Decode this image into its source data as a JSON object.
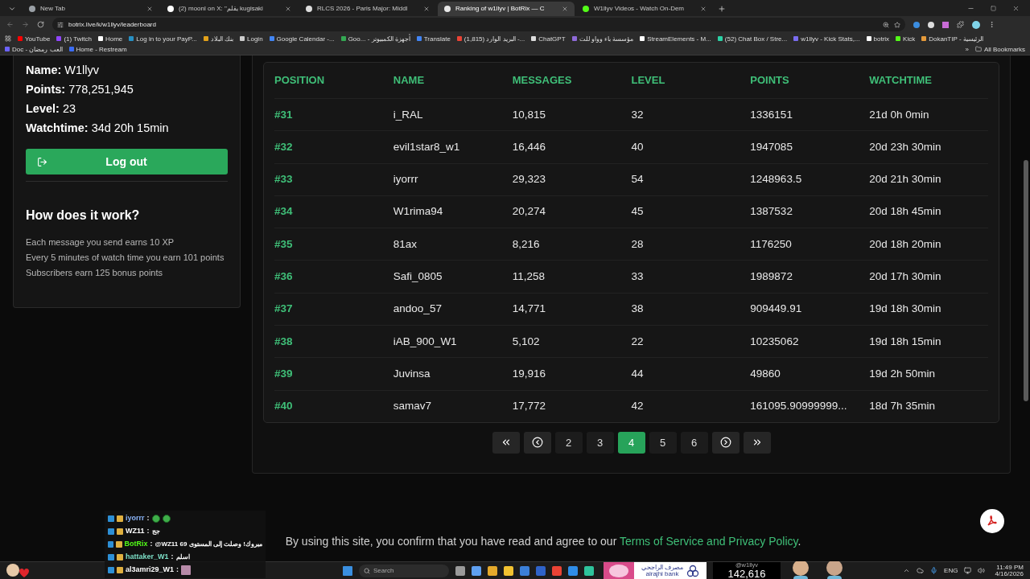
{
  "browser": {
    "tabs": [
      {
        "title": "New Tab",
        "selected": false,
        "color": "#9aa0a6"
      },
      {
        "title": "(2) moonl on X: \"يقلم kugisaki",
        "selected": false,
        "color": "#ffffff"
      },
      {
        "title": "RLCS 2026 - Paris Major: Middl",
        "selected": false,
        "color": "#dddddd"
      },
      {
        "title": "Ranking of w1llyv | BotRix — C",
        "selected": true,
        "color": "#e8e8e8"
      },
      {
        "title": "W1llyv Videos - Watch On-Dem",
        "selected": false,
        "color": "#53fc18"
      }
    ],
    "address": "botrix.live/k/w1llyv/leaderboard",
    "bookmarks": [
      {
        "label": "YouTube",
        "color": "#ff0000"
      },
      {
        "label": "(1) Twitch",
        "color": "#9146ff"
      },
      {
        "label": "Home",
        "color": "#ffffff"
      },
      {
        "label": "Log in to your PayP...",
        "color": "#2790c3"
      },
      {
        "label": "بنك البلاد",
        "color": "#e3a21a"
      },
      {
        "label": "Login",
        "color": "#cccccc"
      },
      {
        "label": "Google Calendar -...",
        "color": "#4285f4"
      },
      {
        "label": "Goo... - أجهزة الكمبيوتر",
        "color": "#34a853"
      },
      {
        "label": "Translate",
        "color": "#4285f4"
      },
      {
        "label": "(1,815) البريد الوارد -...",
        "color": "#ea4335"
      },
      {
        "label": "ChatGPT",
        "color": "#dddddd"
      },
      {
        "label": "مؤسسة باء وواو للت",
        "color": "#8e6ad8"
      },
      {
        "label": "StreamElements - M...",
        "color": "#ffffff"
      },
      {
        "label": "(52) Chat Box / Stre...",
        "color": "#2bd1a5"
      },
      {
        "label": "w1llyv - Kick Stats,...",
        "color": "#7a6cf0"
      },
      {
        "label": "botrix",
        "color": "#ffffff"
      },
      {
        "label": "Kick",
        "color": "#53fc18"
      },
      {
        "label": "DokanTIP - الرئيسية",
        "color": "#e59a3a"
      },
      {
        "label": "Doc - العب رمضان",
        "color": "#6c63ff"
      },
      {
        "label": "Home - Restream",
        "color": "#3b6cf6"
      }
    ],
    "more": "»",
    "all_bookmarks": "All Bookmarks"
  },
  "profile": {
    "fields": [
      {
        "label": "Name:",
        "value": "W1llyv"
      },
      {
        "label": "Points:",
        "value": "778,251,945"
      },
      {
        "label": "Level:",
        "value": "23"
      },
      {
        "label": "Watchtime:",
        "value": "34d 20h 15min"
      }
    ],
    "logout": "Log out",
    "how_title": "How does it work?",
    "how_lines": [
      "Each message you send earns 10 XP",
      "Every 5 minutes of watch time you earn 101 points",
      "Subscribers earn 125 bonus points"
    ]
  },
  "leaderboard": {
    "columns": [
      "POSITION",
      "NAME",
      "MESSAGES",
      "LEVEL",
      "POINTS",
      "WATCHTIME"
    ],
    "rows": [
      [
        "#31",
        "i_RAL",
        "10,815",
        "32",
        "1336151",
        "21d 0h 0min"
      ],
      [
        "#32",
        "evil1star8_w1",
        "16,446",
        "40",
        "1947085",
        "20d 23h 30min"
      ],
      [
        "#33",
        "iyorrr",
        "29,323",
        "54",
        "1248963.5",
        "20d 21h 30min"
      ],
      [
        "#34",
        "W1rima94",
        "20,274",
        "45",
        "1387532",
        "20d 18h 45min"
      ],
      [
        "#35",
        "81ax",
        "8,216",
        "28",
        "1176250",
        "20d 18h 20min"
      ],
      [
        "#36",
        "Safi_0805",
        "11,258",
        "33",
        "1989872",
        "20d 17h 30min"
      ],
      [
        "#37",
        "andoo_57",
        "14,771",
        "38",
        "909449.91",
        "19d 18h 30min"
      ],
      [
        "#38",
        "iAB_900_W1",
        "5,102",
        "22",
        "10235062",
        "19d 18h 15min"
      ],
      [
        "#39",
        "Juvinsa",
        "19,916",
        "44",
        "49860",
        "19d 2h 50min"
      ],
      [
        "#40",
        "samav7",
        "17,772",
        "42",
        "161095.90999999...",
        "18d 7h 35min"
      ]
    ]
  },
  "pagination": {
    "pages": [
      {
        "label": "2",
        "selected": false
      },
      {
        "label": "3",
        "selected": false
      },
      {
        "label": "4",
        "selected": true
      },
      {
        "label": "5",
        "selected": false
      },
      {
        "label": "6",
        "selected": false
      }
    ]
  },
  "footer": {
    "text": "By using this site, you confirm that you have read and agree to our",
    "link": "Terms of Service and Privacy Policy",
    "end": "."
  },
  "stream_overlay": {
    "chat": [
      {
        "user": "iyorrr",
        "color": "#8ab4f8",
        "separator": ":",
        "emotes": [
          {
            "kind": "face"
          },
          {
            "kind": "face"
          }
        ]
      },
      {
        "user": "WZ11",
        "color": "#ffffff",
        "separator": ":",
        "message": "جج"
      },
      {
        "user": "BotRix",
        "color": "#53fc18",
        "separator": ":",
        "message": "@WZ11 مبروك! وصلت إلى المستوى 69"
      },
      {
        "user": "hattaker_W1",
        "color": "#7de0c8",
        "separator": ":",
        "message": "اسلم"
      },
      {
        "user": "al3amri29_W1",
        "color": "#ffffff",
        "separator": ":"
      }
    ],
    "ad_text": "مصرف الراجحي",
    "ad_brand": "alrajhi bank",
    "counter_label": "@w1llyv",
    "counter": "142,616"
  },
  "taskbar": {
    "search": "Search",
    "language": "ENG",
    "time": "11:49 PM",
    "date": "4/16/2026"
  }
}
